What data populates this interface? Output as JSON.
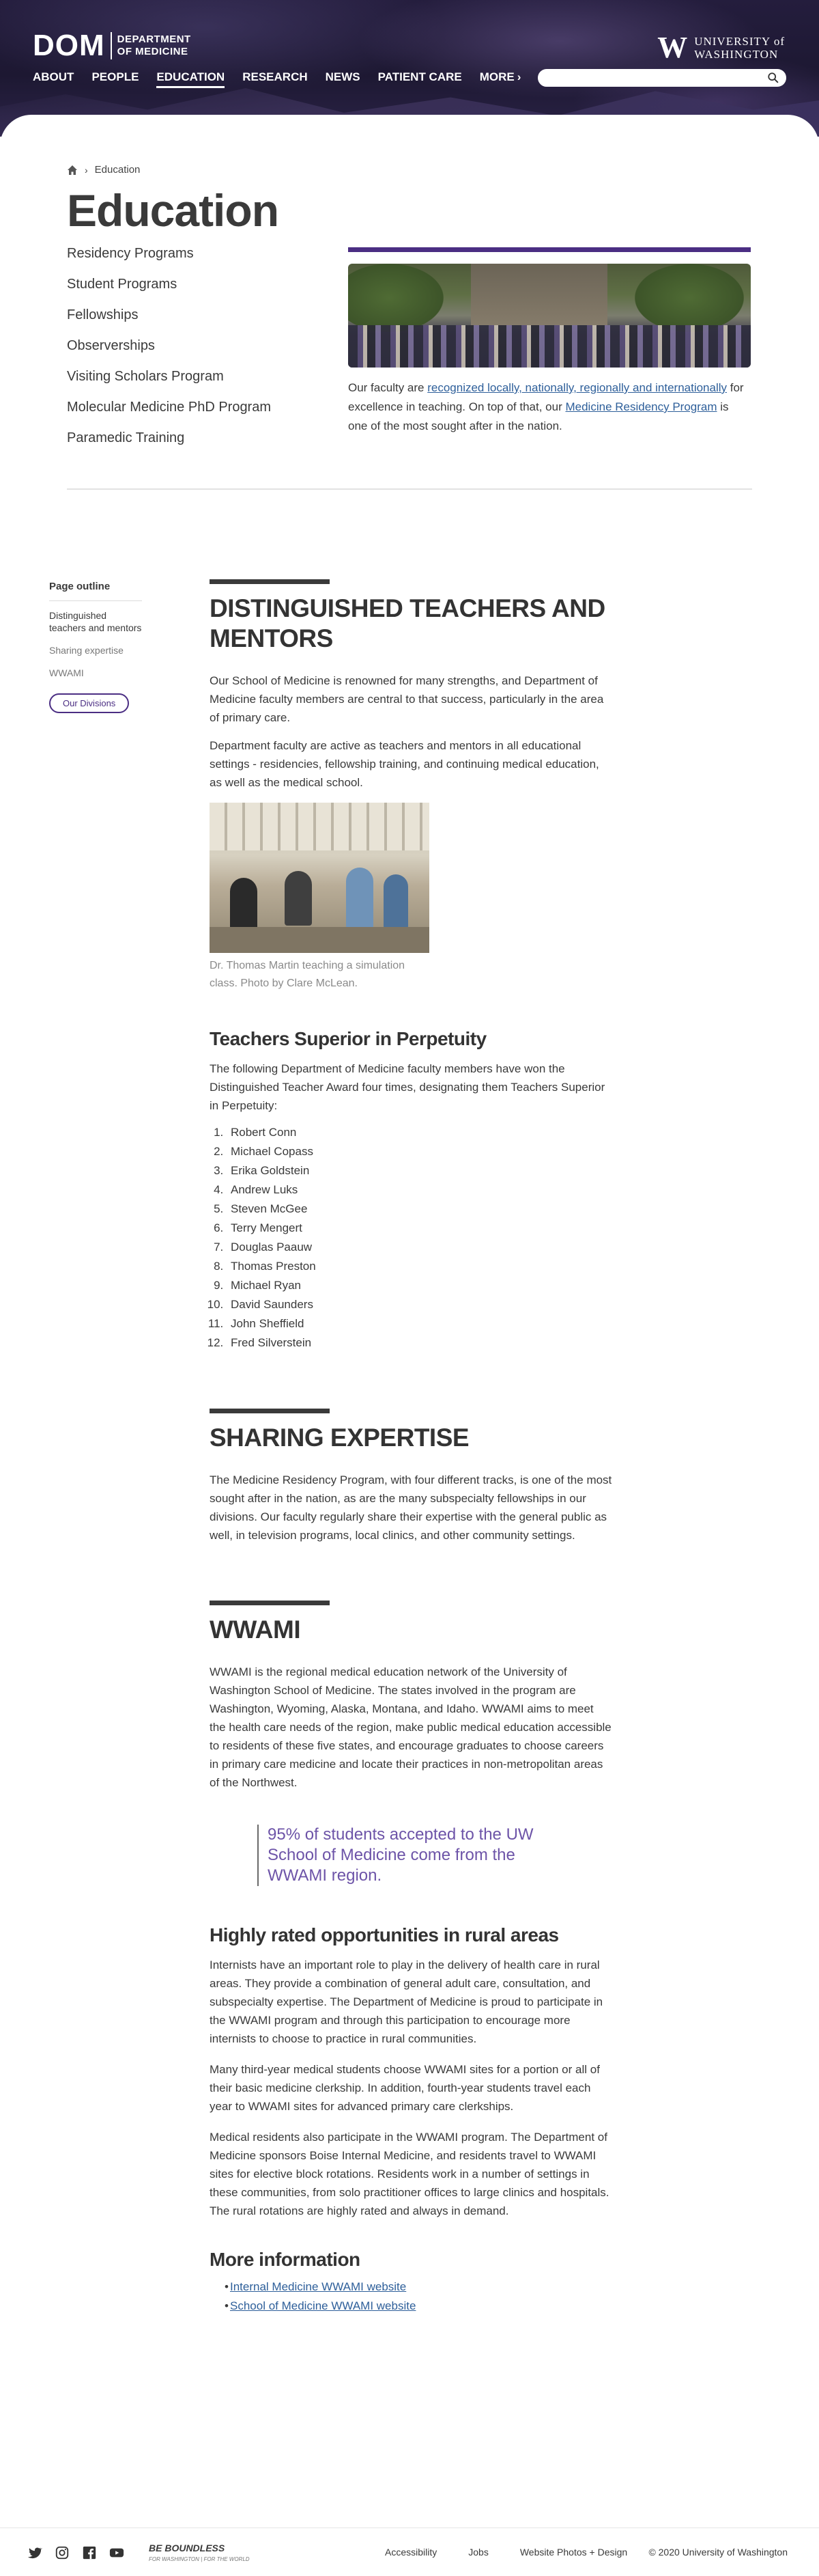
{
  "header": {
    "logo_big": "DOM",
    "logo_line1": "DEPARTMENT",
    "logo_line2": "OF MEDICINE",
    "uw_line1": "UNIVERSITY of",
    "uw_line2": "WASHINGTON",
    "nav": [
      {
        "label": "ABOUT"
      },
      {
        "label": "PEOPLE"
      },
      {
        "label": "EDUCATION"
      },
      {
        "label": "RESEARCH"
      },
      {
        "label": "NEWS"
      },
      {
        "label": "PATIENT CARE"
      },
      {
        "label": "MORE"
      }
    ],
    "more_chevron": "›",
    "search_placeholder": ""
  },
  "breadcrumb": {
    "current": "Education"
  },
  "page_title": "Education",
  "subnav": [
    "Residency Programs",
    "Student Programs",
    "Fellowships",
    "Observerships",
    "Visiting Scholars Program",
    "Molecular Medicine PhD Program",
    "Paramedic Training"
  ],
  "intro": {
    "t1": "Our faculty are ",
    "link1": "recognized locally, nationally, regionally and internationally",
    "t2": " for excellence in teaching. On top of that, our ",
    "link2": "Medicine Residency Program",
    "t3": " is one of the most sought after in the nation."
  },
  "sidebar": {
    "title": "Page outline",
    "items": [
      "Distinguished teachers and mentors",
      "Sharing expertise",
      "WWAMI"
    ],
    "button": "Our Divisions"
  },
  "sections": {
    "teachers": {
      "title": "DISTINGUISHED TEACHERS AND MENTORS",
      "p1": "Our School of Medicine is renowned for many strengths, and Department of Medicine faculty members are central to that success, particularly in the area of primary care.",
      "p2": "Department faculty are active as teachers and mentors in all educational settings - residencies, fellowship training, and continuing medical education, as well as the medical school.",
      "caption": "Dr. Thomas Martin teaching a simulation class. Photo by Clare McLean.",
      "sub_title": "Teachers Superior in Perpetuity",
      "sub_p": "The following Department of Medicine faculty members have won the Distinguished Teacher Award four times, designating them Teachers Superior in Perpetuity:",
      "names": [
        "Robert Conn",
        "Michael Copass",
        "Erika Goldstein",
        "Andrew Luks",
        "Steven McGee",
        "Terry Mengert",
        "Douglas Paauw",
        "Thomas Preston",
        "Michael Ryan",
        "David Saunders",
        "John Sheffield",
        "Fred Silverstein"
      ]
    },
    "sharing": {
      "title": "SHARING EXPERTISE",
      "p1": "The Medicine Residency Program, with four different tracks, is one of the most sought after in the nation, as are the many subspecialty fellowships in our divisions. Our faculty regularly share their expertise with the general public as well, in television programs, local clinics, and other community settings."
    },
    "wwami": {
      "title": "WWAMI",
      "p1": "WWAMI is the regional medical education network of the University of Washington School of Medicine. The states involved in the program are Washington, Wyoming, Alaska, Montana, and Idaho. WWAMI aims to meet the health care needs of the region, make public medical education accessible to residents of these five states, and encourage graduates to choose careers in primary care medicine and locate their practices in non-metropolitan areas of the Northwest.",
      "quote": "95% of students accepted to the UW School of Medicine come from the WWAMI region.",
      "sub_title": "Highly rated opportunities in rural areas",
      "p2": "Internists have an important role to play in the delivery of health care in rural areas. They provide a combination of general adult care, consultation, and subspecialty expertise. The Department of Medicine is proud to participate in the WWAMI program and through this participation to encourage more internists to choose to practice in rural communities.",
      "p3": "Many third-year medical students choose WWAMI sites for a portion or all of their basic medicine clerkship. In addition, fourth-year students travel each year to WWAMI sites for advanced primary care clerkships.",
      "p4": "Medical residents also participate in the WWAMI program. The Department of Medicine sponsors Boise Internal Medicine, and residents travel to WWAMI sites for elective block rotations. Residents work in a number of settings in these communities, from solo practitioner offices to large clinics and hospitals. The rural rotations are highly rated and always in demand.",
      "more_title": "More information",
      "links": [
        "Internal Medicine WWAMI website",
        "School of Medicine WWAMI website"
      ]
    }
  },
  "footer": {
    "social": [
      "twitter-icon",
      "instagram-icon",
      "facebook-icon",
      "youtube-icon"
    ],
    "bb": "BE BOUNDLESS",
    "bb_sub": "FOR WASHINGTON | FOR THE WORLD",
    "links": [
      "Accessibility",
      "Jobs",
      "Website Photos + Design"
    ],
    "copyright": "© 2020 University of Washington"
  },
  "colors": {
    "brand_purple": "#4b2e83",
    "header_bg": "#1d1832",
    "link_blue": "#2e5f9a",
    "quote_purple": "#6d54a8"
  }
}
